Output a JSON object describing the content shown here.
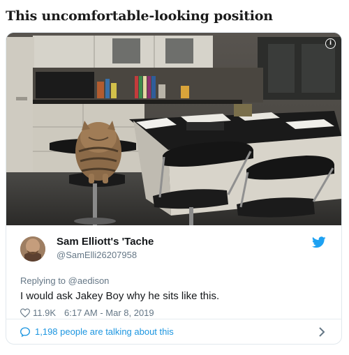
{
  "article": {
    "headline": "This uncomfortable-looking position"
  },
  "photo": {
    "info_glyph": "i",
    "subject": "cat-on-bar-stool"
  },
  "tweet": {
    "display_name": "Sam Elliott's 'Tache",
    "handle": "@SamElli26207958",
    "replying_prefix": "Replying to",
    "replying_to": "@aedison",
    "text": "I would ask Jakey Boy why he sits like this.",
    "likes": "11.9K",
    "timestamp": "6:17 AM - Mar 8, 2019",
    "conversation": "1,198 people are talking about this"
  },
  "colors": {
    "twitter_blue": "#1da1f2",
    "link_blue": "#1b95e0",
    "muted_text": "#657786",
    "primary_text": "#14171a"
  },
  "icons": {
    "info": "info-icon",
    "brand": "twitter-bird-icon",
    "like": "heart-icon",
    "reply": "speech-bubble-icon",
    "more": "chevron-right-icon"
  }
}
